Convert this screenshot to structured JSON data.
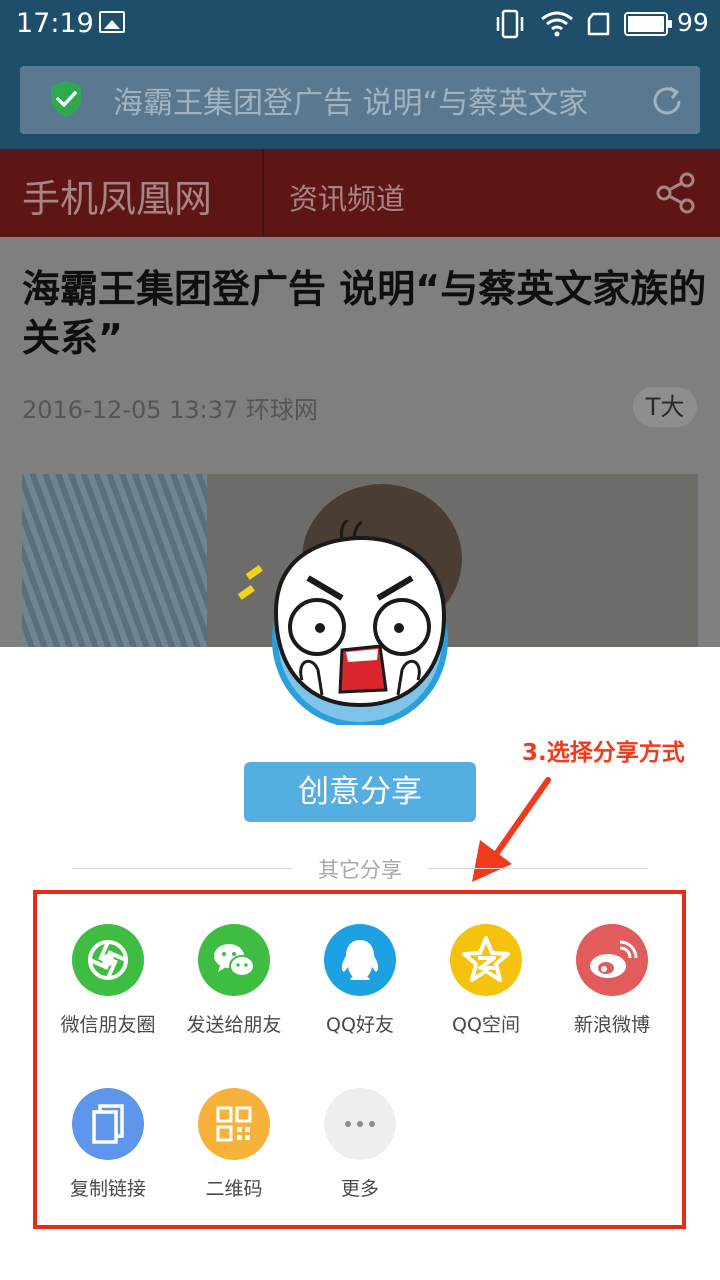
{
  "status_bar": {
    "time": "17:19",
    "battery": "99"
  },
  "url_bar": {
    "text": "海霸王集团登广告 说明“与蔡英文家"
  },
  "site_header": {
    "logo": "手机凤凰网",
    "channel": "资讯频道"
  },
  "article": {
    "title": "海霸王集团登广告 说明“与蔡英文家族的关系”",
    "meta": "2016-12-05 13:37 环球网",
    "font_size_button": "T大"
  },
  "share_sheet": {
    "creative_share": "创意分享",
    "other_share": "其它分享",
    "annotation": "3.选择分享方式",
    "options": [
      {
        "label": "微信朋友圈",
        "icon": "wechat-moments-icon",
        "color": "#3fbd43"
      },
      {
        "label": "发送给朋友",
        "icon": "wechat-icon",
        "color": "#3fbd43"
      },
      {
        "label": "QQ好友",
        "icon": "qq-icon",
        "color": "#1da1e2"
      },
      {
        "label": "QQ空间",
        "icon": "qzone-icon",
        "color": "#f5c30d"
      },
      {
        "label": "新浪微博",
        "icon": "weibo-icon",
        "color": "#e35c5c"
      },
      {
        "label": "复制链接",
        "icon": "copy-link-icon",
        "color": "#5e96ec"
      },
      {
        "label": "二维码",
        "icon": "qr-code-icon",
        "color": "#f7b23b"
      },
      {
        "label": "更多",
        "icon": "more-icon",
        "color": "#eeeeee"
      }
    ]
  }
}
